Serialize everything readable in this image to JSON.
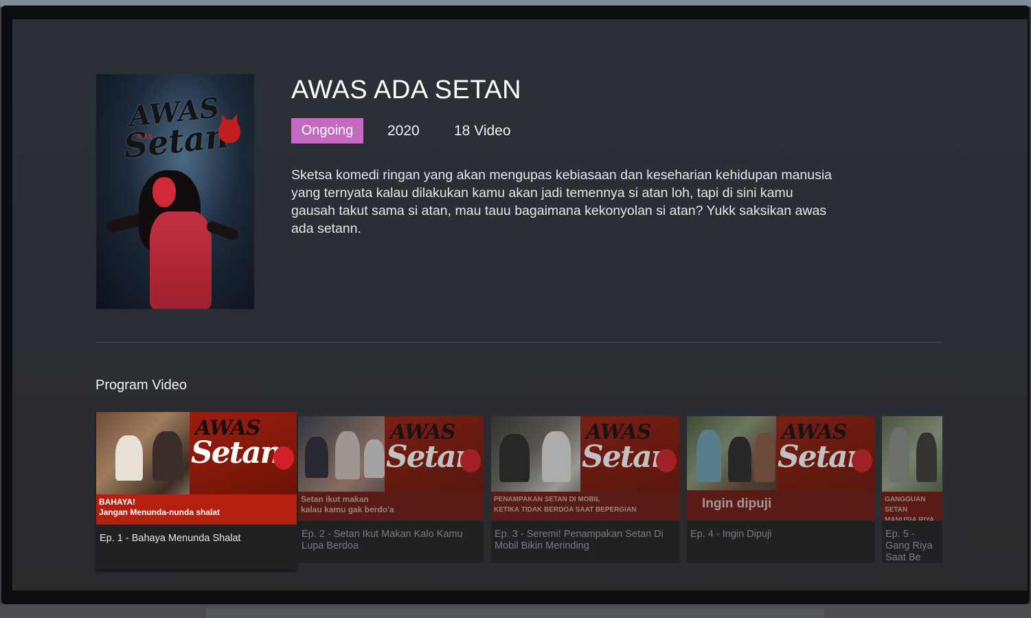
{
  "show": {
    "title": "AWAS ADA SETAN",
    "status_badge": "Ongoing",
    "year": "2020",
    "video_count": "18 Video",
    "description": "Sketsa komedi ringan yang akan mengupas kebiasaan dan keseharian kehidupan manusia yang ternyata kalau dilakukan kamu akan jadi temennya si atan loh, tapi di sini kamu gausah takut sama si atan, mau tauu bagaimana kekonyolan si atan? Yukk saksikan awas ada setann.",
    "poster": {
      "logo_line1": "AWAS",
      "logo_small": "ADA",
      "logo_line2": "Setan"
    }
  },
  "colors": {
    "badge": "#c56ac1",
    "brand_red": "#b51f0f",
    "background": "#2b3037"
  },
  "section": {
    "title": "Program Video"
  },
  "thumbnail_brand": {
    "word1": "AWAS",
    "word2": "Setan"
  },
  "episodes": [
    {
      "caption": "Ep. 1 - Bahaya Menunda Shalat",
      "strip_line1": "BAHAYA!",
      "strip_line2": "Jangan Menunda-nunda shalat",
      "focused": true
    },
    {
      "caption": "Ep. 2 - Setan Ikut Makan Kalo Kamu Lupa Berdoa",
      "strip_line1": "Setan ikut makan",
      "strip_line2": "kalau kamu gak berdo'a",
      "focused": false
    },
    {
      "caption": "Ep. 3 - Seremi! Penampakan Setan Di Mobil Bikin Merinding",
      "strip_line1": "PENAMPAKAN SETAN DI MOBIL",
      "strip_line2": "KETIKA TIDAK BERDOA SAAT BEPERGIAN",
      "focused": false
    },
    {
      "caption": "Ep. 4 - Ingin Dipuji",
      "strip_big": "Ingin dipuji",
      "focused": false
    },
    {
      "caption": "Ep. 5 - Gang Riya Saat Be",
      "strip_line1": "GANGGUAN SETAN",
      "strip_line2": "MANUSIA RIYA SA",
      "focused": false
    }
  ]
}
